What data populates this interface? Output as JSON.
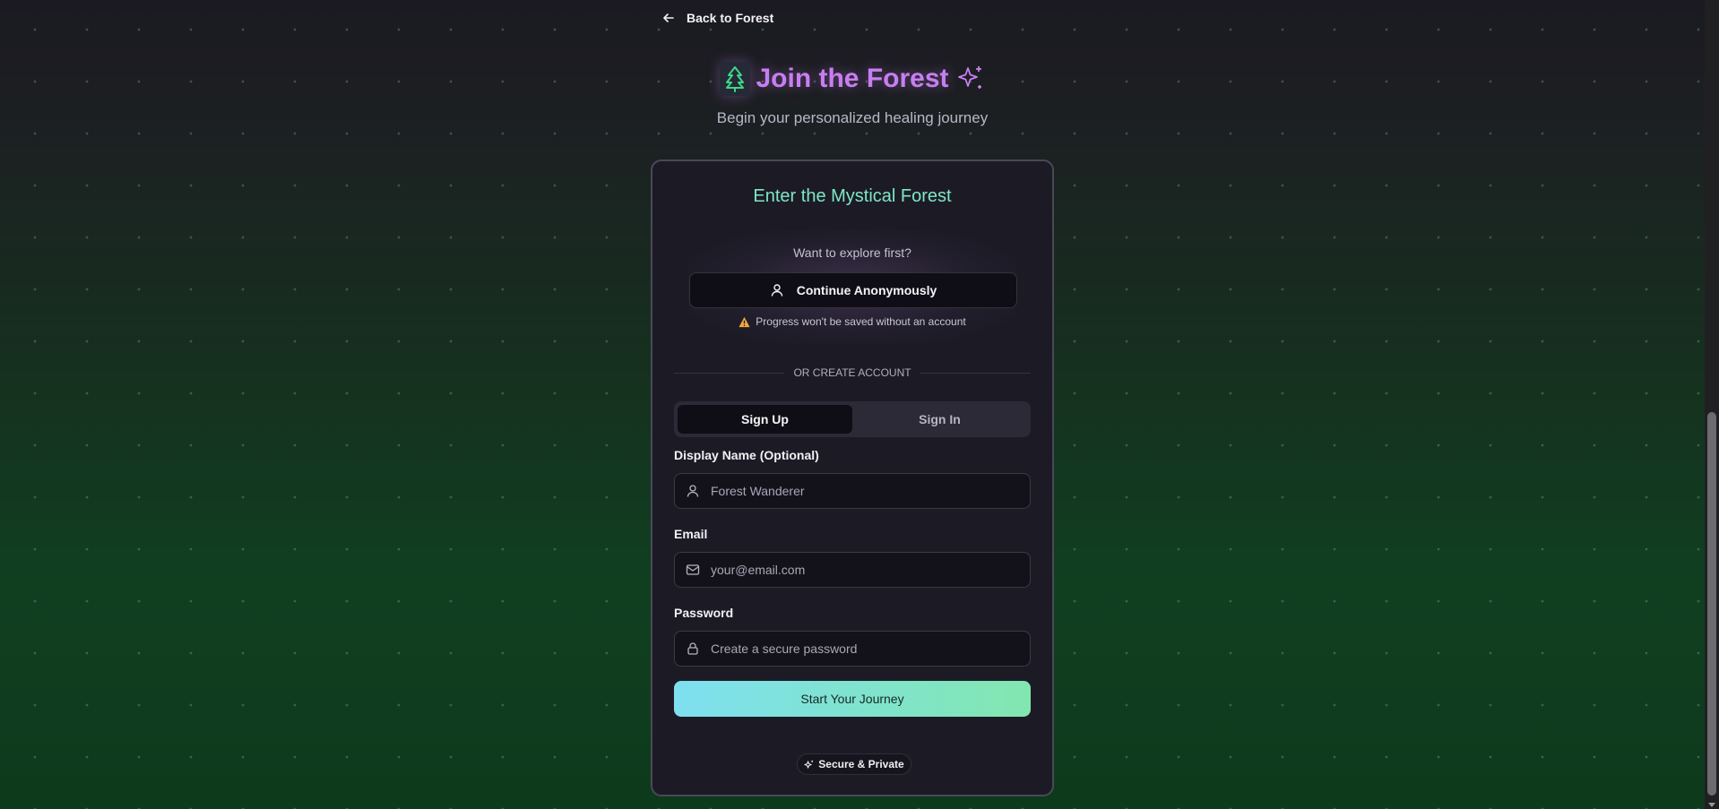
{
  "nav": {
    "back_label": "Back to Forest"
  },
  "hero": {
    "title": "Join the Forest",
    "subtitle": "Begin your personalized healing journey",
    "tree_icon": "tree-icon",
    "sparkle_icon": "sparkles-icon"
  },
  "card": {
    "title": "Enter the Mystical Forest",
    "anonymous": {
      "question": "Want to explore first?",
      "button_label": "Continue Anonymously",
      "warning": "Progress won't be saved without an account"
    },
    "divider": "OR CREATE ACCOUNT",
    "tabs": [
      {
        "label": "Sign Up",
        "active": true
      },
      {
        "label": "Sign In",
        "active": false
      }
    ],
    "fields": {
      "display_name": {
        "label": "Display Name (Optional)",
        "placeholder": "Forest Wanderer",
        "value": ""
      },
      "email": {
        "label": "Email",
        "placeholder": "your@email.com",
        "value": ""
      },
      "password": {
        "label": "Password",
        "placeholder": "Create a secure password",
        "value": ""
      }
    },
    "submit_label": "Start Your Journey",
    "badge": "Secure & Private"
  },
  "colors": {
    "accent_purple": "#c77ef0",
    "accent_teal": "#7ee7c6",
    "button_gradient_start": "#7ee0f0",
    "button_gradient_end": "#82e6b0",
    "warning": "#f2a93b"
  }
}
